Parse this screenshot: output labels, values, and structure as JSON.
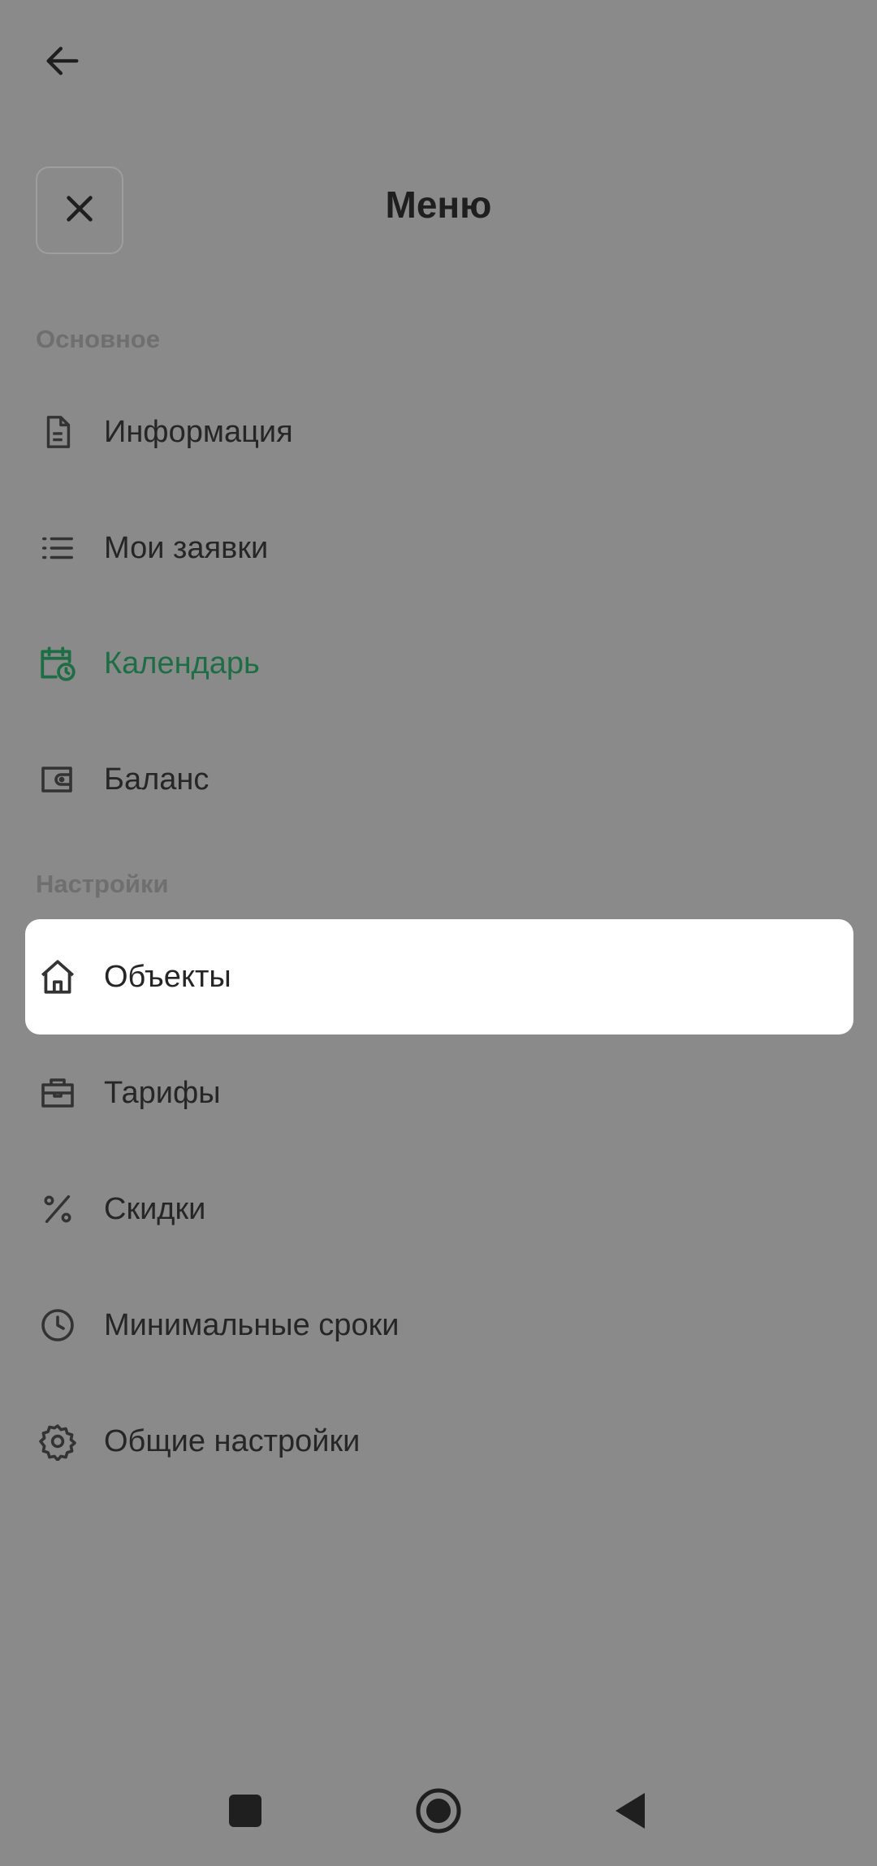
{
  "header": {
    "title": "Меню",
    "back_icon": "arrow-left-icon",
    "close_icon": "close-icon"
  },
  "sections": [
    {
      "title": "Основное",
      "items": [
        {
          "label": "Информация",
          "icon": "document-icon"
        },
        {
          "label": "Мои заявки",
          "icon": "list-icon"
        },
        {
          "label": "Календарь",
          "icon": "calendar-clock-icon",
          "active": true
        },
        {
          "label": "Баланс",
          "icon": "wallet-icon"
        }
      ]
    },
    {
      "title": "Настройки",
      "items": [
        {
          "label": "Объекты",
          "icon": "house-icon",
          "selected": true
        },
        {
          "label": "Тарифы",
          "icon": "briefcase-icon"
        },
        {
          "label": "Скидки",
          "icon": "percent-icon"
        },
        {
          "label": "Минимальные сроки",
          "icon": "clock-icon"
        },
        {
          "label": "Общие настройки",
          "icon": "gear-icon"
        }
      ]
    }
  ],
  "nav_bar": {
    "recents_icon": "square-icon",
    "home_icon": "circle-icon",
    "back_icon": "triangle-back-icon"
  },
  "colors": {
    "overlay_background": "#8a8a8a",
    "active_item": "#1e6e45",
    "selected_item_background": "#ffffff",
    "section_title": "#6f6f6f",
    "text": "#262626"
  }
}
